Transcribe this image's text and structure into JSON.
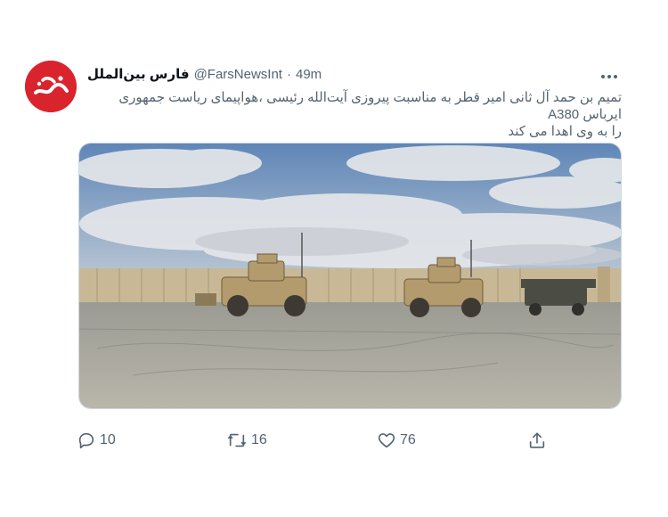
{
  "author": {
    "display_name": "فارس بین‌الملل",
    "handle": "@FarsNewsInt",
    "separator": "·",
    "time": "49m",
    "avatar_logo": "فارس",
    "avatar_color": "#d9232d"
  },
  "tweet": {
    "text_line_1": "تمیم بن حمد آل ثانی امیر قطر به مناسبت پیروزی آیت‌الله رئیسی ،هواپیمای ریاست جمهوری ایرباس A380",
    "text_line_2": "را به وی اهدا می کند"
  },
  "media": {
    "description_icon": "photo-military-vehicles"
  },
  "actions": {
    "reply_count": "10",
    "retweet_count": "16",
    "like_count": "76",
    "reply_icon": "reply-icon",
    "retweet_icon": "retweet-icon",
    "like_icon": "heart-icon",
    "share_icon": "share-icon"
  },
  "colors": {
    "muted_text": "#536471",
    "name_text": "#0f1419"
  }
}
